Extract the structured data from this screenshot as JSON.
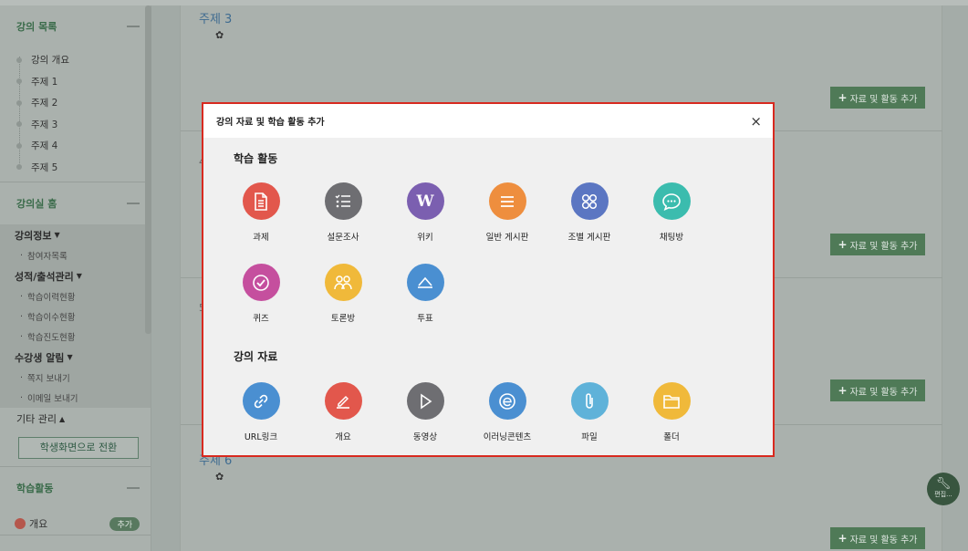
{
  "sidebar": {
    "course_list_title": "강의 목록",
    "toc": [
      "강의 개요",
      "주제 1",
      "주제 2",
      "주제 3",
      "주제 4",
      "주제 5"
    ],
    "classroom_home_title": "강의실 홈",
    "groups": [
      {
        "title": "강의정보",
        "items": [
          "참여자목록"
        ]
      },
      {
        "title": "성적/출석관리",
        "items": [
          "학습이력현황",
          "학습이수현황",
          "학습진도현황"
        ]
      },
      {
        "title": "수강생 알림",
        "items": [
          "쪽지 보내기",
          "이메일 보내기"
        ]
      }
    ],
    "etc_title": "기타 관리",
    "switch_button": "학생화면으로 전환",
    "activities_title": "학습활동",
    "activity_row": {
      "label": "개요",
      "add": "추가"
    }
  },
  "main": {
    "topic3_title": "주제 3",
    "topic6_title": "주제 6",
    "add_button": "자료 및 활동 추가"
  },
  "edit_fab": "편집...",
  "modal": {
    "title": "강의 자료 및 학습 활동 추가",
    "close": "×",
    "activities_heading": "학습 활동",
    "resources_heading": "강의 자료",
    "activities": [
      {
        "label": "과제",
        "icon": "assignment-icon",
        "color": "#e2574c"
      },
      {
        "label": "설문조사",
        "icon": "survey-icon",
        "color": "#6e6e72"
      },
      {
        "label": "위키",
        "icon": "wiki-icon",
        "color": "#7b5fb0"
      },
      {
        "label": "일반 게시판",
        "icon": "board-icon",
        "color": "#ee8e3e"
      },
      {
        "label": "조별 게시판",
        "icon": "group-board-icon",
        "color": "#5b76c2"
      },
      {
        "label": "채팅방",
        "icon": "chat-icon",
        "color": "#3bbcae"
      },
      {
        "label": "퀴즈",
        "icon": "quiz-icon",
        "color": "#c54f9e"
      },
      {
        "label": "토론방",
        "icon": "forum-icon",
        "color": "#f0b93a"
      },
      {
        "label": "투표",
        "icon": "vote-icon",
        "color": "#4a8fd1"
      }
    ],
    "resources": [
      {
        "label": "URL링크",
        "icon": "link-icon",
        "color": "#4a8fd1"
      },
      {
        "label": "개요",
        "icon": "pencil-icon",
        "color": "#e2574c"
      },
      {
        "label": "동영상",
        "icon": "play-icon",
        "color": "#6e6e72"
      },
      {
        "label": "이러닝콘텐츠",
        "icon": "elearning-icon",
        "color": "#4a8fd1"
      },
      {
        "label": "파일",
        "icon": "paperclip-icon",
        "color": "#5fb2d9"
      },
      {
        "label": "폴더",
        "icon": "folder-icon",
        "color": "#f0b93a"
      }
    ]
  }
}
